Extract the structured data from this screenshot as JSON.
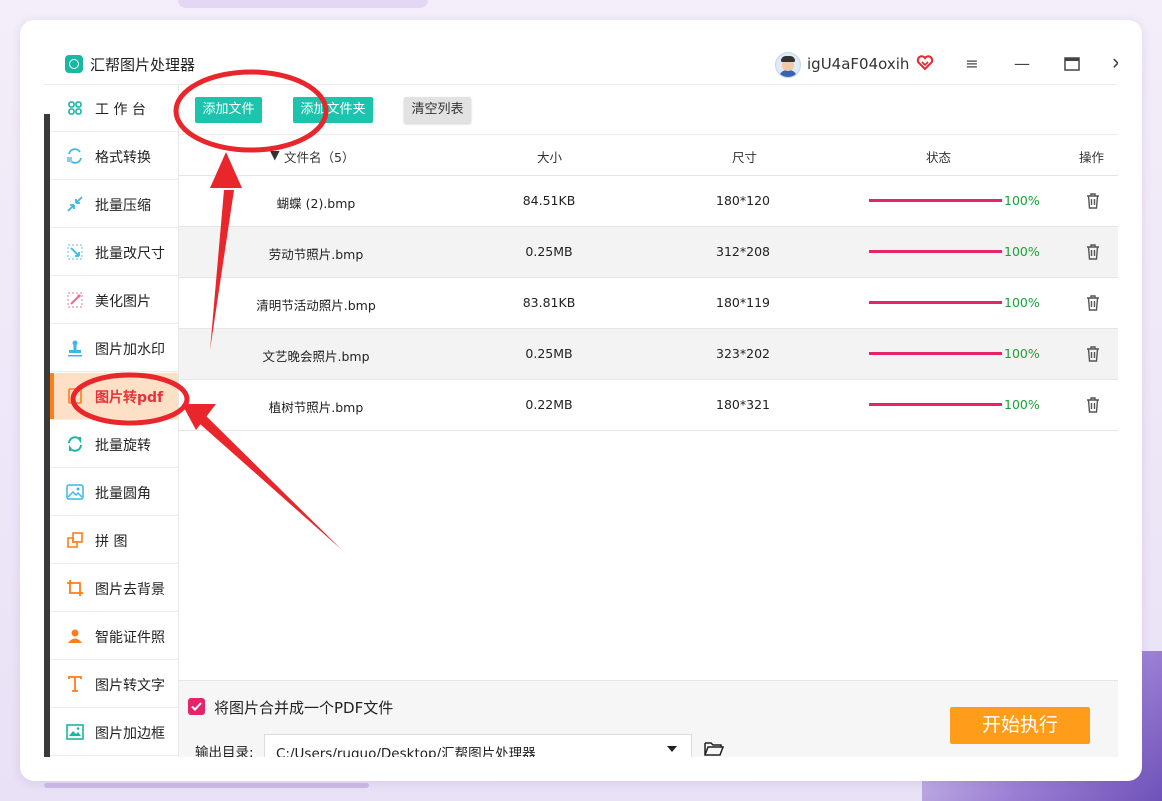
{
  "app": {
    "title": "汇帮图片处理器",
    "username": "igU4aF04oxih"
  },
  "window_controls": {
    "menu": "≡",
    "minimize": "—",
    "maximize": "□",
    "close": "✕"
  },
  "sidebar": {
    "items": [
      {
        "label": "工 作 台",
        "icon": "grid-icon",
        "active": false
      },
      {
        "label": "格式转换",
        "icon": "convert-icon",
        "active": false
      },
      {
        "label": "批量压缩",
        "icon": "compress-icon",
        "active": false
      },
      {
        "label": "批量改尺寸",
        "icon": "resize-icon",
        "active": false
      },
      {
        "label": "美化图片",
        "icon": "beautify-icon",
        "active": false
      },
      {
        "label": "图片加水印",
        "icon": "watermark-icon",
        "active": false
      },
      {
        "label": "图片转pdf",
        "icon": "pdf-icon",
        "active": true
      },
      {
        "label": "批量旋转",
        "icon": "rotate-icon",
        "active": false
      },
      {
        "label": "批量圆角",
        "icon": "round-corner-icon",
        "active": false
      },
      {
        "label": "拼    图",
        "icon": "collage-icon",
        "active": false
      },
      {
        "label": "图片去背景",
        "icon": "crop-icon",
        "active": false
      },
      {
        "label": "智能证件照",
        "icon": "person-icon",
        "active": false
      },
      {
        "label": "图片转文字",
        "icon": "text-icon",
        "active": false
      },
      {
        "label": "图片加边框",
        "icon": "frame-icon",
        "active": false
      }
    ]
  },
  "toolbar": {
    "add_file": "添加文件",
    "add_folder": "添加文件夹",
    "clear_list": "清空列表"
  },
  "table": {
    "headers": {
      "name": "文件名（5）",
      "size": "大小",
      "dimensions": "尺寸",
      "status": "状态",
      "actions": "操作"
    },
    "rows": [
      {
        "name": "蝴蝶 (2).bmp",
        "size": "84.51KB",
        "dimensions": "180*120",
        "progress": 100,
        "progress_text": "100%"
      },
      {
        "name": "劳动节照片.bmp",
        "size": "0.25MB",
        "dimensions": "312*208",
        "progress": 100,
        "progress_text": "100%"
      },
      {
        "name": "清明节活动照片.bmp",
        "size": "83.81KB",
        "dimensions": "180*119",
        "progress": 100,
        "progress_text": "100%"
      },
      {
        "name": "文艺晚会照片.bmp",
        "size": "0.25MB",
        "dimensions": "323*202",
        "progress": 100,
        "progress_text": "100%"
      },
      {
        "name": "植树节照片.bmp",
        "size": "0.22MB",
        "dimensions": "180*321",
        "progress": 100,
        "progress_text": "100%"
      }
    ]
  },
  "footer": {
    "merge_checked": true,
    "merge_label": "将图片合并成一个PDF文件",
    "output_label": "输出目录:",
    "output_path": "C:/Users/ruguo/Desktop/汇帮图片处理器",
    "start_label": "开始执行"
  },
  "colors": {
    "accent_teal": "#1bc5ad",
    "accent_orange": "#ff9c1a",
    "progress_pink": "#e6246a",
    "annotation_red": "#e8262b"
  }
}
